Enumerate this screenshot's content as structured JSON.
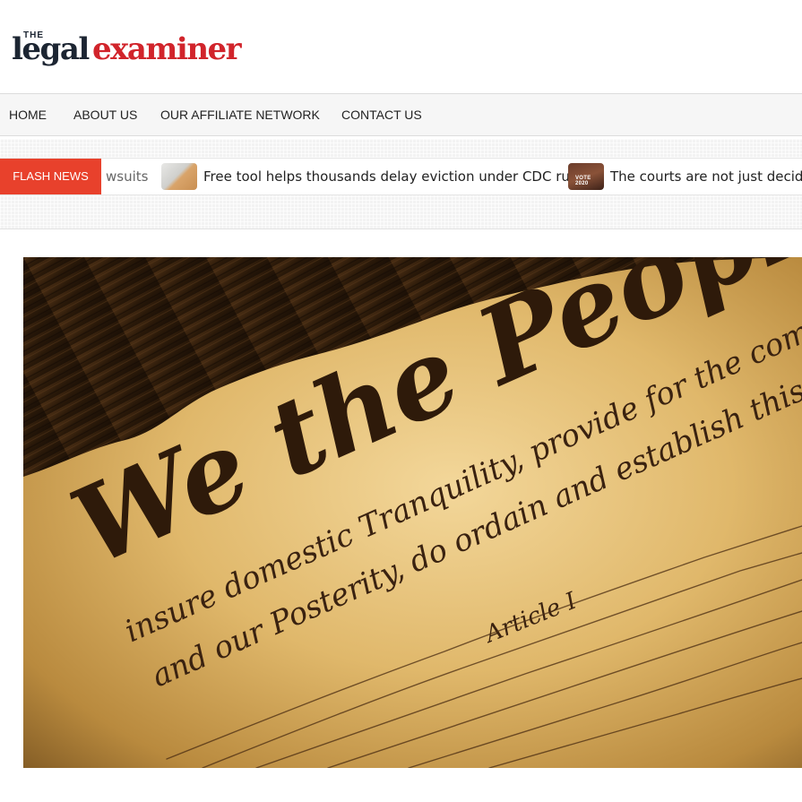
{
  "logo": {
    "the": "THE",
    "legal": "legal",
    "examiner": "examiner"
  },
  "nav": {
    "items": [
      {
        "label": "HOME"
      },
      {
        "label": "ABOUT US"
      },
      {
        "label": "OUR AFFILIATE NETWORK"
      },
      {
        "label": "CONTACT US"
      }
    ]
  },
  "ticker": {
    "flash_label": "FLASH NEWS",
    "items": [
      {
        "text": "wsuits"
      },
      {
        "text": "Free tool helps thousands delay eviction under CDC rules"
      },
      {
        "text": "The courts are not just deciding"
      }
    ],
    "thumb2_caption": "VOTE 2020"
  },
  "hero": {
    "script_big": "We the People",
    "script_line1": "insure domestic Tranquility, provide for the common",
    "script_line2": "and our Posterity, do ordain and establish this",
    "script_article": "Article I"
  },
  "colors": {
    "brand_dark": "#1c2532",
    "brand_red": "#d1242b",
    "flash_bg": "#e8412c"
  }
}
